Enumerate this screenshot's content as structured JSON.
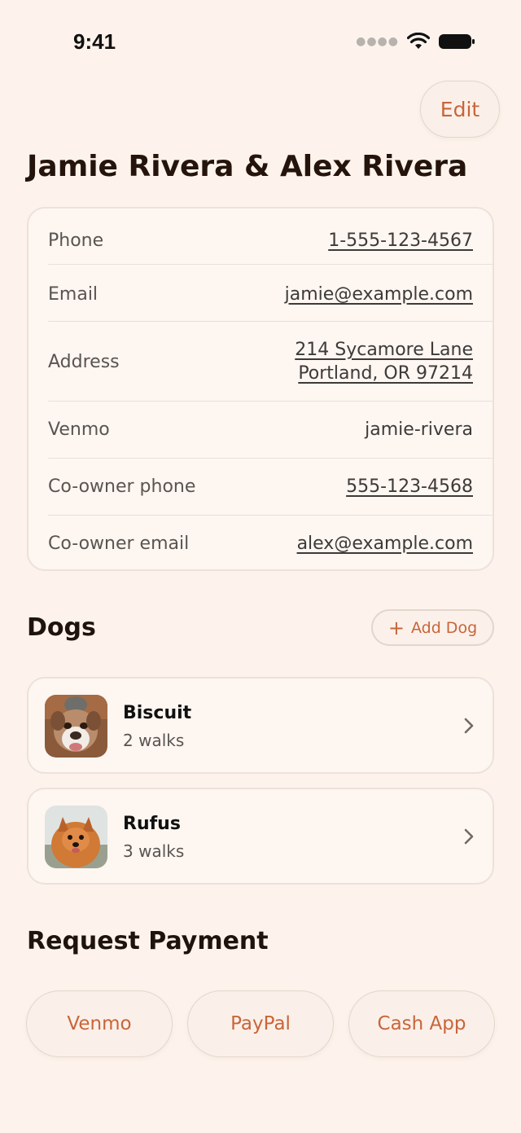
{
  "status_bar": {
    "time": "9:41"
  },
  "header": {
    "edit_label": "Edit",
    "title": "Jamie Rivera & Alex Rivera"
  },
  "contact": {
    "rows": [
      {
        "label": "Phone",
        "value": "1-555-123-4567"
      },
      {
        "label": "Email",
        "value": "jamie@example.com"
      },
      {
        "label": "Address",
        "value_line1": "214 Sycamore Lane",
        "value_line2": "Portland, OR 97214"
      },
      {
        "label": "Venmo",
        "value": "jamie-rivera"
      },
      {
        "label": "Co-owner phone",
        "value": "555-123-4568"
      },
      {
        "label": "Co-owner email",
        "value": "alex@example.com"
      }
    ]
  },
  "dogs": {
    "title": "Dogs",
    "add_label": "Add Dog",
    "items": [
      {
        "name": "Biscuit",
        "walks": "2 walks"
      },
      {
        "name": "Rufus",
        "walks": "3 walks"
      }
    ]
  },
  "payment": {
    "title": "Request Payment",
    "buttons": [
      "Venmo",
      "PayPal",
      "Cash App"
    ]
  },
  "colors": {
    "background": "#fdf3ec",
    "accent": "#c8653a",
    "card_border": "#ece2db"
  }
}
